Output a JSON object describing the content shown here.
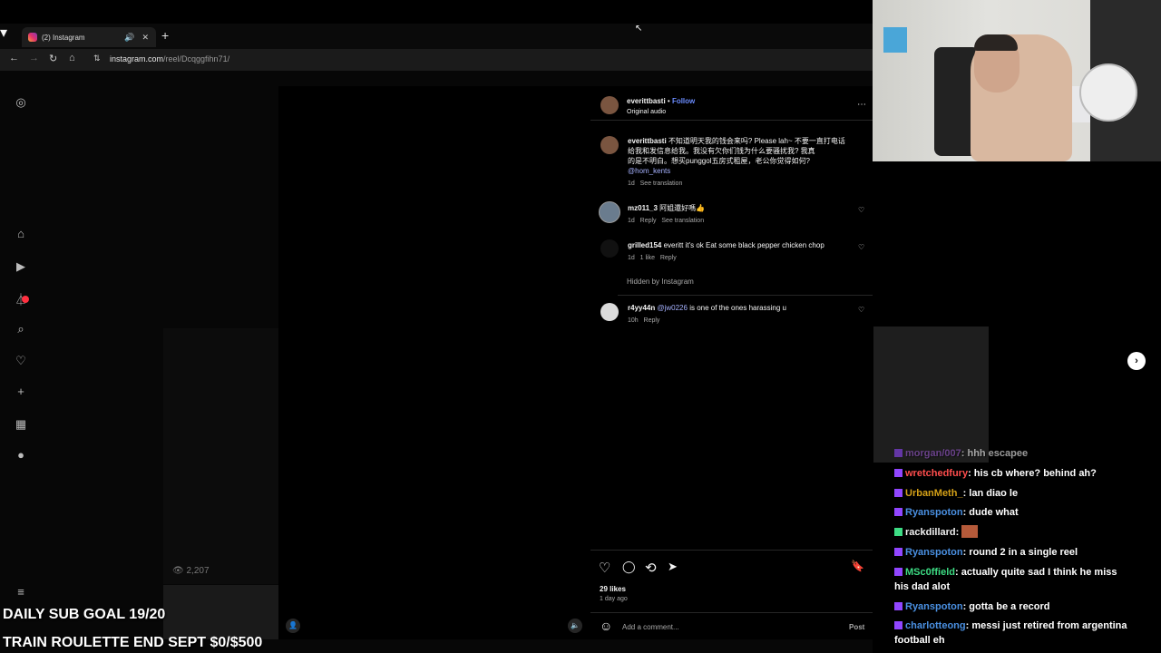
{
  "browser": {
    "tab_title": "(2) Instagram",
    "url_domain": "instagram.com",
    "url_path": "/reel/Dcqggfihn71/"
  },
  "icons": {
    "chevron": "▾",
    "audio": "🔊",
    "close": "✕",
    "plus": "+",
    "back": "←",
    "forward": "→",
    "reload": "↻",
    "home": "⌂",
    "site": "⇅",
    "cursor": "↖",
    "insta": "◎",
    "reels": "▶",
    "explore": "⏃",
    "search": "⌕",
    "notif": "♡",
    "create": "+",
    "dash": "▦",
    "profile": "●",
    "menu": "≡",
    "views": "👁",
    "user": "👤",
    "sound": "🔈",
    "more": "⋯",
    "heart_small": "♡",
    "like": "♡",
    "comment": "◯",
    "repost": "⟲",
    "share": "➤",
    "save": "🔖",
    "emoji": "☺",
    "next": "›"
  },
  "reel": {
    "views": "2,207",
    "author": "everittbasti",
    "follow_label": "Follow",
    "audio": "Original audio",
    "caption_user": "everittbasti",
    "caption_text": "不知道明天我的钱会来吗? Please lah~ 不要一直打电话",
    "caption_text2": "给我和发信息给我。我没有欠你们钱为什么要骚扰我? 我真",
    "caption_text3": "的是不明白。想买punggol五房式租屋，老公你觉得如何?",
    "caption_mention": "@hom_kents",
    "caption_meta_time": "1d",
    "caption_meta_translate": "See translation",
    "likes": "29 likes",
    "date": "1 day ago",
    "add_comment_placeholder": "Add a comment...",
    "post_label": "Post",
    "hidden_label": "Hidden by Instagram"
  },
  "comments": [
    {
      "user": "mz011_3",
      "text": "阿姐還好嗎👍",
      "time": "1d",
      "action1": "Reply",
      "action2": "See translation"
    },
    {
      "user": "grilled154",
      "text": "everitt it's ok Eat some black pepper chicken chop",
      "time": "1d",
      "action1": "1 like",
      "action2": "Reply"
    },
    {
      "user": "r4yy44n",
      "mention": "@jw0226",
      "text": "is one of the ones harassing u",
      "time": "10h",
      "action1": "Reply"
    }
  ],
  "chat": [
    {
      "user": "morgan/007",
      "msg": ": hhh escapee",
      "color": "#9b59d0"
    },
    {
      "user": "wretchedfury",
      "msg": ": his cb where? behind ah?",
      "color": "#ff4d4d"
    },
    {
      "user": "UrbanMeth_",
      "msg": ": lan diao le",
      "color": "#d4a017"
    },
    {
      "user": "Ryanspoton",
      "msg": ": dude what",
      "color": "#4a90e2"
    },
    {
      "user": "rackdillard",
      "msg": ":",
      "color": "#f0f0f0"
    },
    {
      "user": "Ryanspoton",
      "msg": ": round 2 in a single reel",
      "color": "#4a90e2"
    },
    {
      "user": "MSc0ffield",
      "msg": ": actually quite sad I think he miss",
      "cont": "his dad alot",
      "color": "#3ddc84"
    },
    {
      "user": "Ryanspoton",
      "msg": ": gotta be a record",
      "color": "#4a90e2"
    },
    {
      "user": "charlotteong",
      "msg": ": messi just retired from argentina",
      "cont": "football eh",
      "color": "#4a90e2"
    }
  ],
  "overlay": {
    "sub_goal": "DAILY SUB GOAL 19/20",
    "roulette": "TRAIN ROULETTE END SEPT $0/$500"
  },
  "colors": {
    "accent": "#0095f6",
    "link": "#a6b2ff",
    "twitch": "#9146ff"
  }
}
